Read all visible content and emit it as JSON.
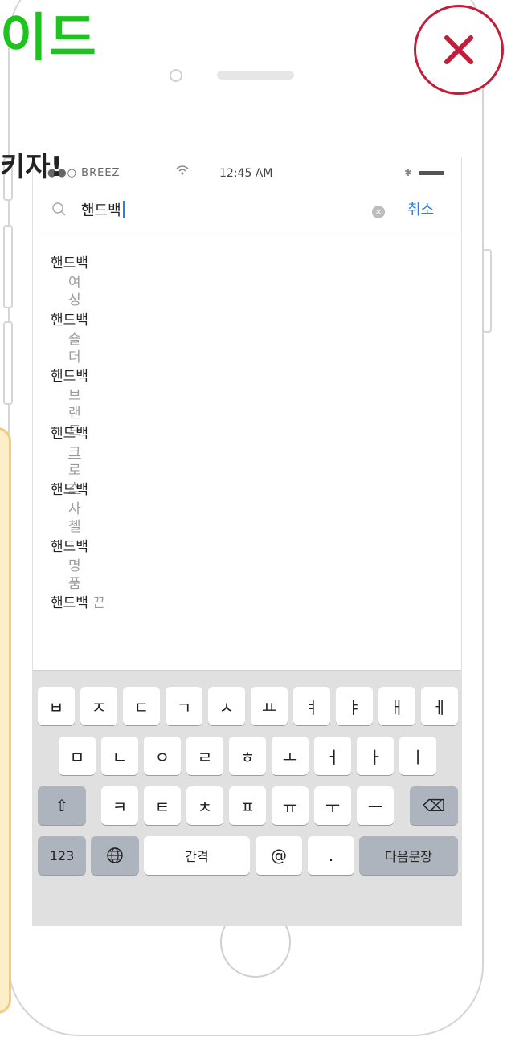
{
  "overlay": {
    "heading": "이드",
    "subheading": "키자!",
    "close_icon": "close-x-icon",
    "accent_red": "#c21e3a",
    "accent_green": "#1ec31e"
  },
  "status_bar": {
    "carrier": "●●○ BREEZ",
    "wifi_icon": "wifi-icon",
    "time": "12:45 AM",
    "bluetooth": "✱"
  },
  "search": {
    "query": "핸드백",
    "cancel_label": "취소",
    "clear_icon": "clear-icon"
  },
  "suggestions": [
    {
      "prefix": "여성 ",
      "keyword": "핸드백",
      "suffix": ""
    },
    {
      "prefix": "숄더 ",
      "keyword": "핸드백",
      "suffix": ""
    },
    {
      "prefix": "브랜드 ",
      "keyword": "핸드백",
      "suffix": ""
    },
    {
      "prefix": "크로스 ",
      "keyword": "핸드백",
      "suffix": ""
    },
    {
      "prefix": "사첼 ",
      "keyword": "핸드백",
      "suffix": ""
    },
    {
      "prefix": "명품 ",
      "keyword": "핸드백",
      "suffix": ""
    },
    {
      "prefix": "",
      "keyword": "핸드백",
      "suffix": " 끈"
    }
  ],
  "keyboard": {
    "row1": [
      "ㅂ",
      "ㅈ",
      "ㄷ",
      "ㄱ",
      "ㅅ",
      "ㅛ",
      "ㅕ",
      "ㅑ",
      "ㅐ",
      "ㅔ"
    ],
    "row2": [
      "ㅁ",
      "ㄴ",
      "ㅇ",
      "ㄹ",
      "ㅎ",
      "ㅗ",
      "ㅓ",
      "ㅏ",
      "ㅣ"
    ],
    "row3": [
      "ㅋ",
      "ㅌ",
      "ㅊ",
      "ㅍ",
      "ㅠ",
      "ㅜ",
      "ㅡ"
    ],
    "shift": "⇧",
    "backspace": "⌫",
    "numbers": "123",
    "globe": "🌐",
    "space": "간격",
    "at": "@",
    "dot": ".",
    "return": "다음문장"
  }
}
